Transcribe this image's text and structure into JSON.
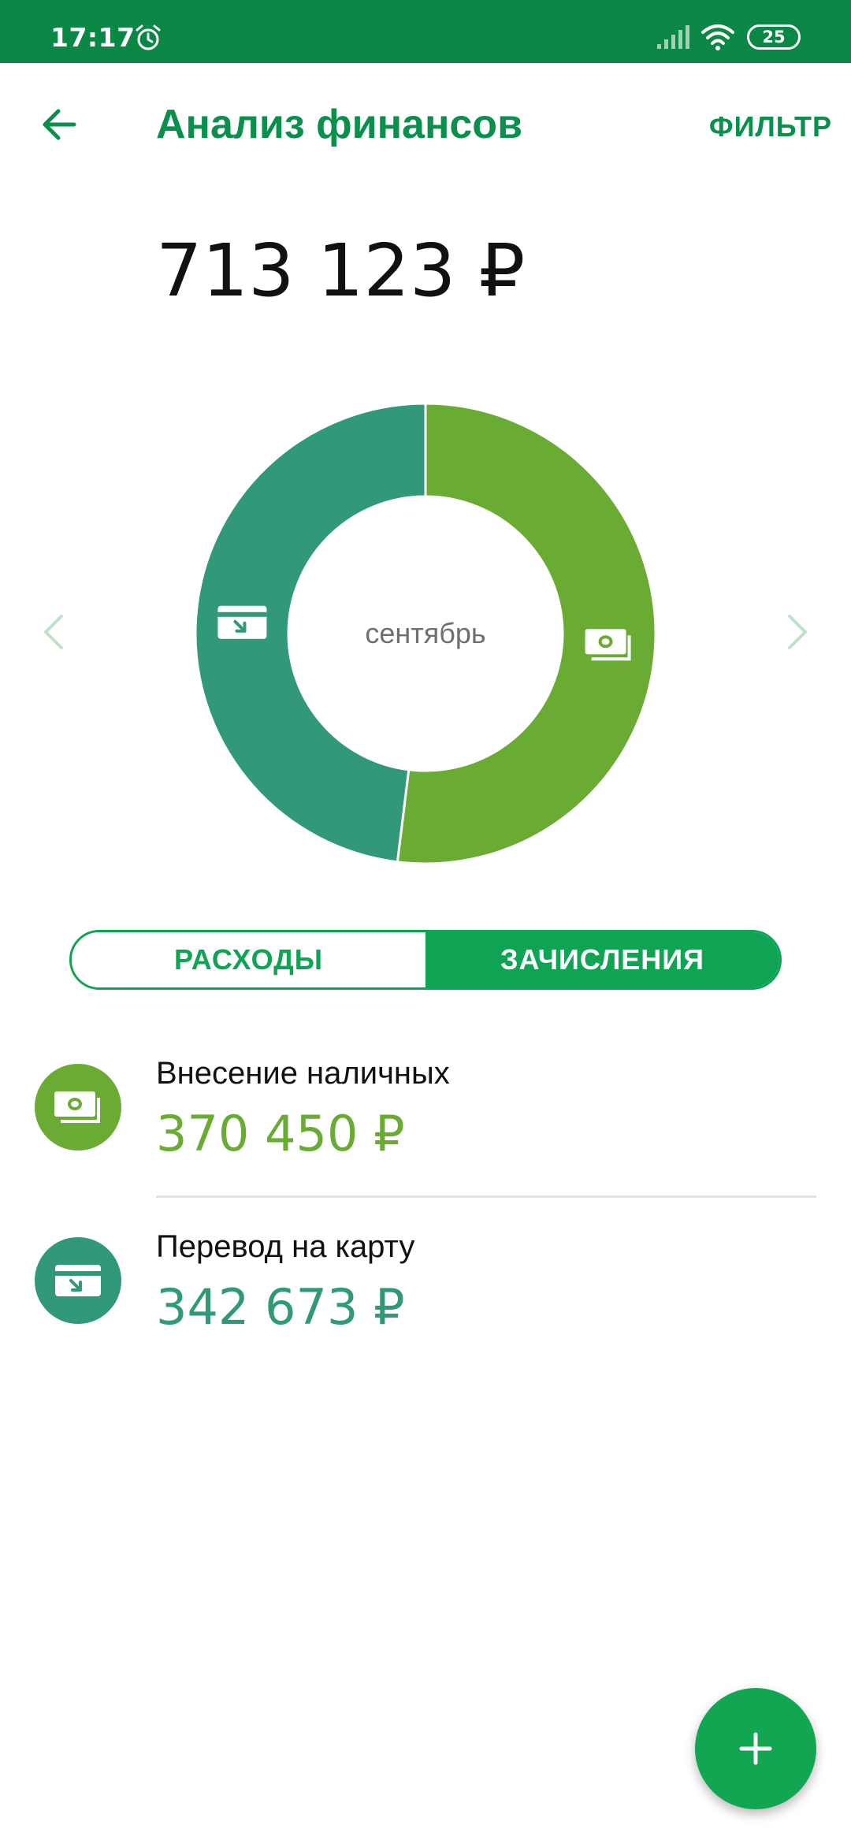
{
  "status_bar": {
    "time": "17:17",
    "battery": "25",
    "icons": [
      "alarm-icon",
      "signal-icon",
      "wifi-icon",
      "battery-icon"
    ]
  },
  "header": {
    "title": "Анализ финансов",
    "filter_label": "ФИЛЬТР",
    "back_icon": "arrow-left-icon"
  },
  "summary": {
    "total": "713 123 ₽"
  },
  "chart_data": {
    "type": "pie",
    "center_label": "сентябрь",
    "slices": [
      {
        "name": "Внесение наличных",
        "value": 370450,
        "color": "#6aab34",
        "icon": "cash-icon"
      },
      {
        "name": "Перевод на карту",
        "value": 342673,
        "color": "#319879",
        "icon": "card-transfer-icon"
      }
    ]
  },
  "toggle": {
    "tabs": [
      {
        "label": "РАСХОДЫ",
        "active": false
      },
      {
        "label": "ЗАЧИСЛЕНИЯ",
        "active": true
      }
    ]
  },
  "list": {
    "items": [
      {
        "label": "Внесение наличных",
        "amount": "370 450 ₽",
        "color": "#6aab34",
        "icon": "cash-icon"
      },
      {
        "label": "Перевод на карту",
        "amount": "342 673 ₽",
        "color": "#319879",
        "icon": "card-transfer-icon"
      }
    ]
  },
  "fab": {
    "icon": "plus-icon"
  },
  "colors": {
    "status_bar": "#0a8744",
    "accent": "#0fa354",
    "nav_arrow": "#bfe3c8"
  }
}
